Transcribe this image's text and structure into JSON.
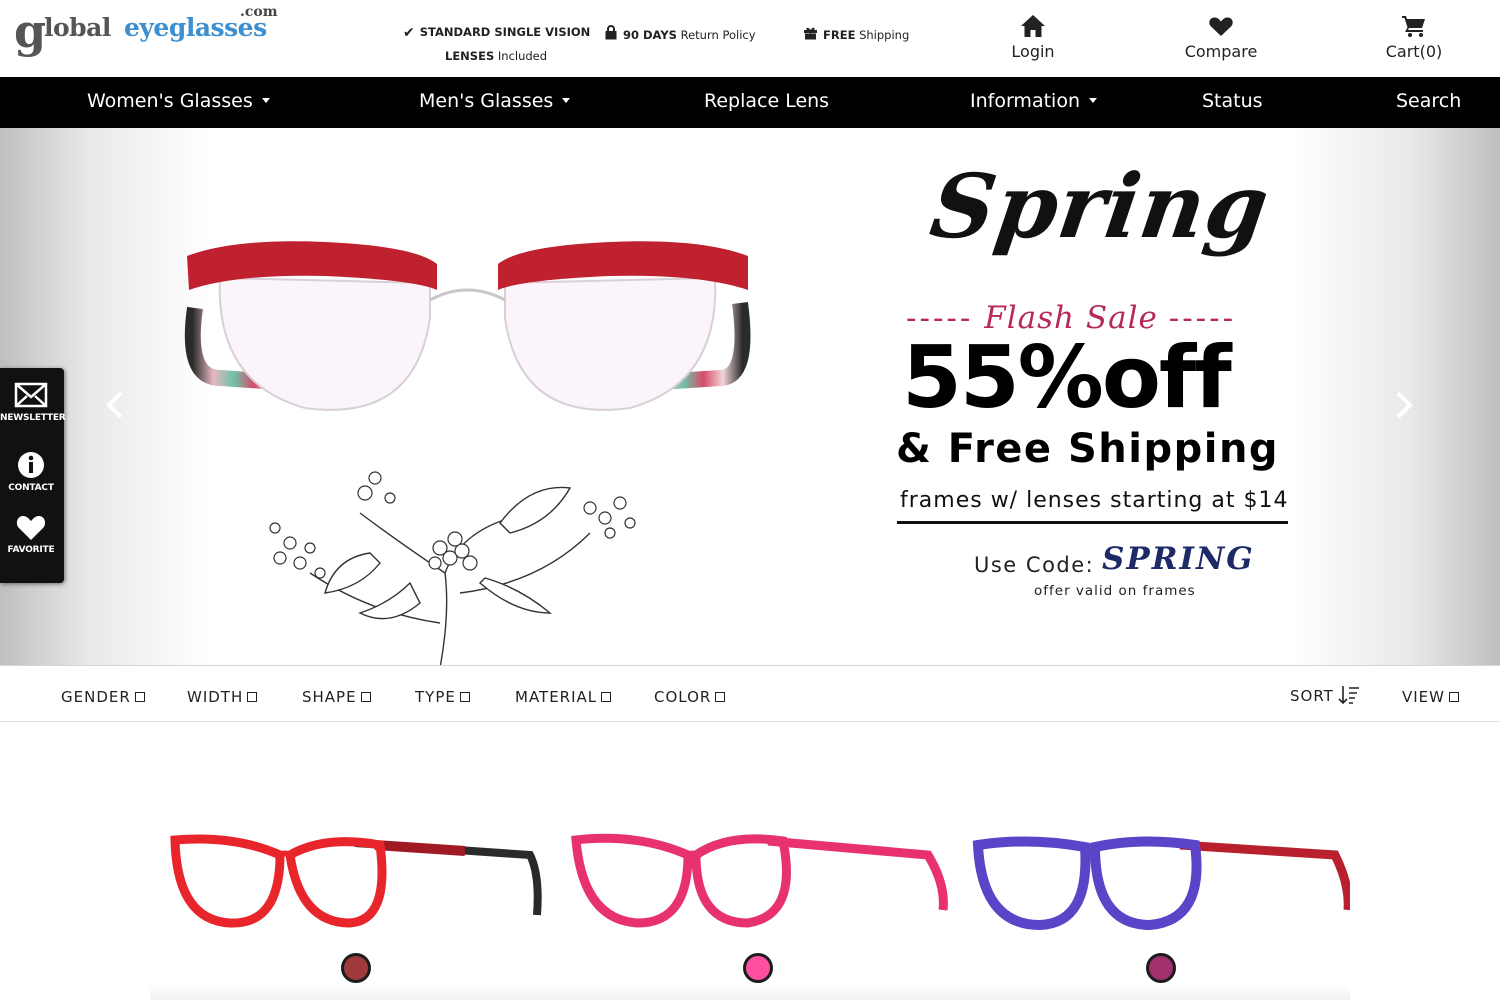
{
  "header": {
    "logo": {
      "g": "g",
      "text_a": "lobal",
      "text_b": "eyeglasses",
      "com": ".com"
    },
    "promos": {
      "vision_bold": "STANDARD SINGLE VISION",
      "vision_line2_bold": "LENSES",
      "vision_line2": " Included",
      "returns_bold": "90 DAYS",
      "returns": " Return Policy",
      "shipping_bold": "FREE",
      "shipping": " Shipping"
    },
    "links": {
      "login": "Login",
      "compare": "Compare",
      "cart": "Cart(0)"
    }
  },
  "nav": {
    "items": [
      {
        "label": "Women's Glasses"
      },
      {
        "label": "Men's Glasses"
      },
      {
        "label": "Replace Lens"
      },
      {
        "label": "Information"
      },
      {
        "label": "Status"
      },
      {
        "label": "Search"
      }
    ]
  },
  "hero": {
    "title": "Spring",
    "subtitle": "Flash Sale",
    "dashes": "-----",
    "discount": "55%off",
    "shipping": "& Free Shipping",
    "frames_text": "frames w/ lenses starting at $14",
    "use_code_label": "Use Code:",
    "code": "SPRING",
    "offer": "offer valid on frames"
  },
  "sidebar": {
    "newsletter": "NEWSLETTER",
    "contact": "CONTACT",
    "favorite": "FAVORITE"
  },
  "filters": {
    "gender": "GENDER",
    "width": "WIDTH",
    "shape": "SHAPE",
    "type": "TYPE",
    "material": "MATERIAL",
    "color": "COLOR",
    "sort": "SORT",
    "view": "VIEW"
  },
  "products": [
    {
      "frame_color": "#e8252b",
      "temple_color": "#222222",
      "swatch_color": "#a03a3a"
    },
    {
      "frame_color": "#e8326e",
      "temple_color": "#e8326e",
      "swatch_color": "#ff4fa0"
    },
    {
      "frame_color": "#5b44c8",
      "temple_color": "#b8202e",
      "swatch_color": "#a0306e"
    }
  ],
  "colors": {
    "brand_blue": "#3d8fcf",
    "flash_pink": "#b8285b",
    "code_navy": "#1d2a66",
    "nav_bg": "#000000"
  }
}
